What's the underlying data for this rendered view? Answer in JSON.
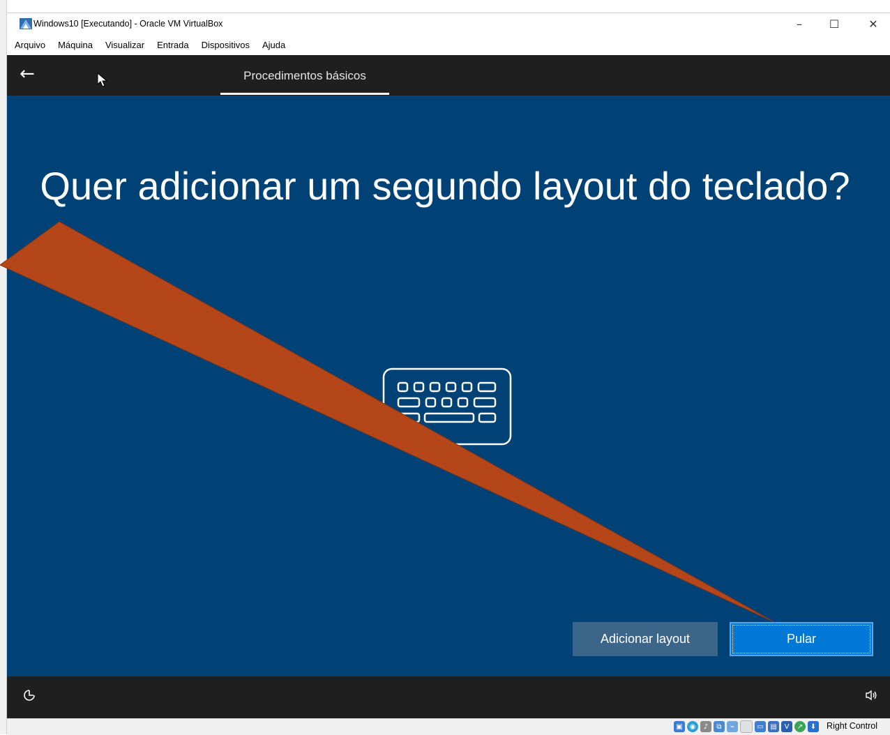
{
  "window": {
    "title": "Windows10 [Executando] - Oracle VM VirtualBox",
    "controls": {
      "minimize": "–",
      "maximize": "☐",
      "close": "✕"
    }
  },
  "menu": [
    "Arquivo",
    "Máquina",
    "Visualizar",
    "Entrada",
    "Dispositivos",
    "Ajuda"
  ],
  "oobe": {
    "back_icon": "←",
    "section_title": "Procedimentos básicos",
    "headline": "Quer adicionar um segundo layout do teclado?",
    "illustration": "keyboard-icon",
    "buttons": {
      "add_layout": "Adicionar layout",
      "skip": "Pular"
    },
    "accessibility_icon": "accessibility-icon",
    "volume_icon": "volume-icon"
  },
  "statusbar": {
    "icons": [
      "hard-disk-icon",
      "optical-drive-icon",
      "audio-icon",
      "network-icon",
      "usb-icon",
      "shared-folders-icon",
      "display-icon",
      "video-capture-icon",
      "virtualization-icon",
      "mouse-integration-icon",
      "keyboard-capture-icon"
    ],
    "host_key": "Right Control"
  },
  "colors": {
    "oobe_background": "#004275",
    "skip_button": "#0078d7",
    "add_button": "#3b6589",
    "annotation_arrow": "#b5461a"
  }
}
